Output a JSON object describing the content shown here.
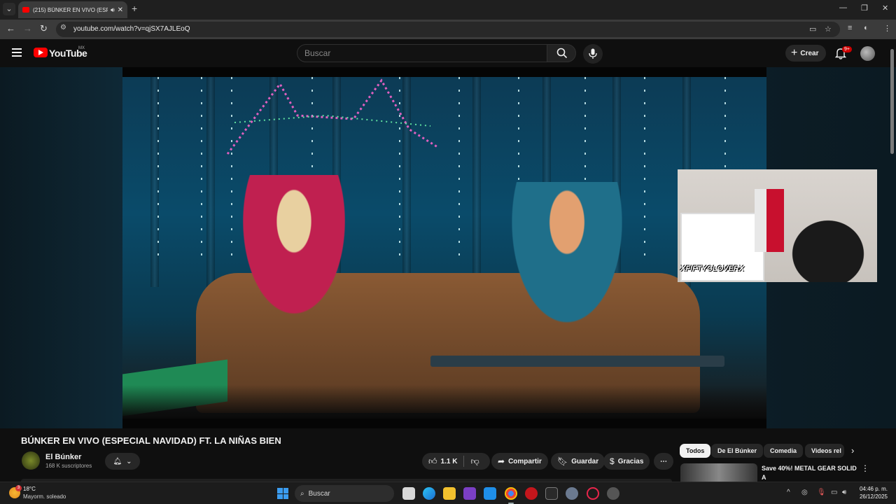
{
  "browser": {
    "tab_title": "(215) BÚNKER EN VIVO (ESP",
    "url": "youtube.com/watch?v=qjSX7AJLEoQ"
  },
  "youtube": {
    "logo_text": "YouTube",
    "country": "MX",
    "search_placeholder": "Buscar",
    "create_label": "Crear",
    "notification_count": "9+"
  },
  "video": {
    "title": "BÚNKER EN VIVO (ESPECIAL NAVIDAD) FT. LA NIÑAS BIEN",
    "overlay_tag": "XFIFTYCLOVERX",
    "channel_name": "El Búnker",
    "channel_subs": "168 K suscriptores",
    "likes": "1.1 K",
    "share_label": "Compartir",
    "save_label": "Guardar",
    "thanks_label": "Gracias",
    "more_label": "⋯"
  },
  "chips": [
    {
      "label": "Todos",
      "active": true
    },
    {
      "label": "De El Búnker",
      "active": false
    },
    {
      "label": "Comedia",
      "active": false
    },
    {
      "label": "Videos rel",
      "active": false
    }
  ],
  "recommendation": {
    "title": "Save 40%! METAL GEAR SOLID A"
  },
  "taskbar": {
    "weather_badge": "3",
    "temperature": "18°C",
    "weather": "Mayorm. soleado",
    "search_label": "Buscar",
    "time": "04:46 p. m.",
    "date": "26/12/2025"
  },
  "colors": {
    "accent_red": "#ff0000",
    "background": "#0f0f0f",
    "chip_active": "#f1f1f1"
  }
}
